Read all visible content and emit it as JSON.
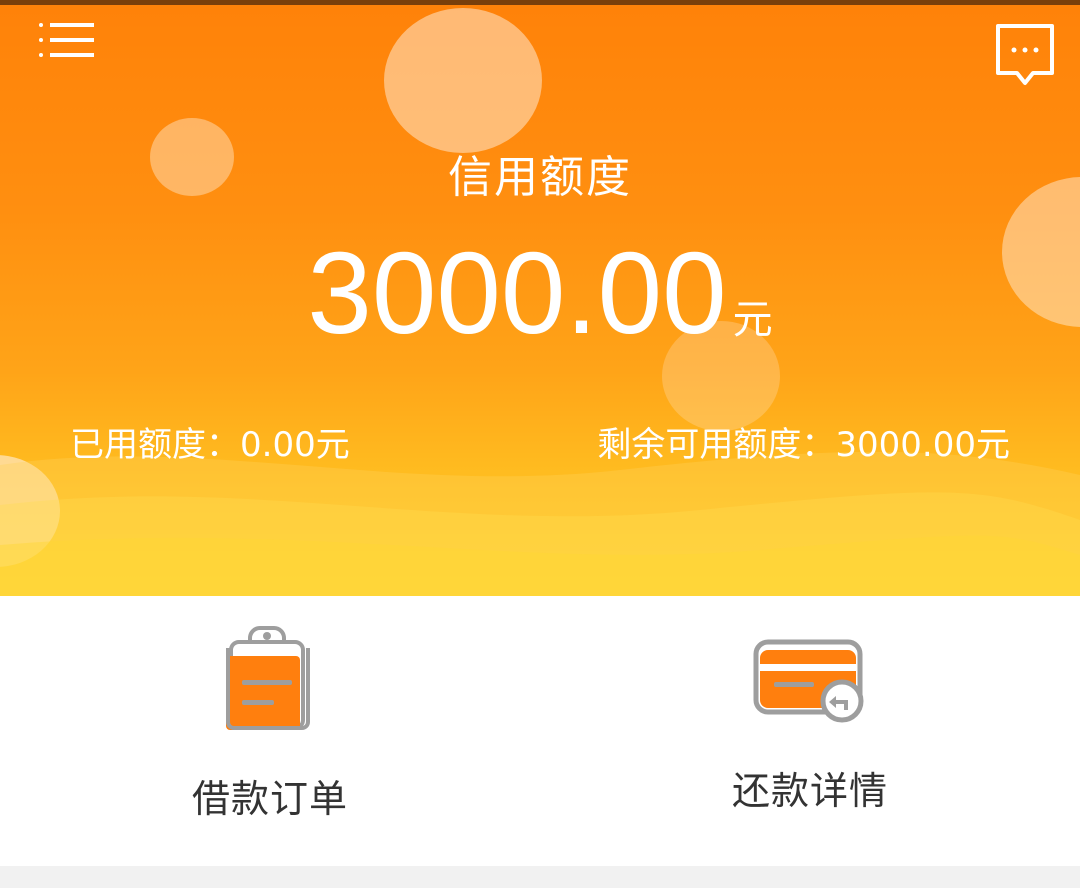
{
  "header": {
    "menu_icon": "menu-icon",
    "message_icon": "chat-bubble-icon"
  },
  "credit": {
    "title": "信用额度",
    "amount": "3000.00",
    "unit": "元",
    "used_label": "已用额度：",
    "used_value": "0.00元",
    "remaining_label": "剩余可用额度：",
    "remaining_value": "3000.00元"
  },
  "actions": {
    "loan_orders": {
      "label": "借款订单",
      "icon": "clipboard-icon"
    },
    "repayment_details": {
      "label": "还款详情",
      "icon": "card-repay-icon"
    }
  },
  "colors": {
    "gradient_top": "#ff8209",
    "gradient_bottom": "#ffd426",
    "accent": "#ff7f0e",
    "icon_gray": "#9e9e9e"
  }
}
